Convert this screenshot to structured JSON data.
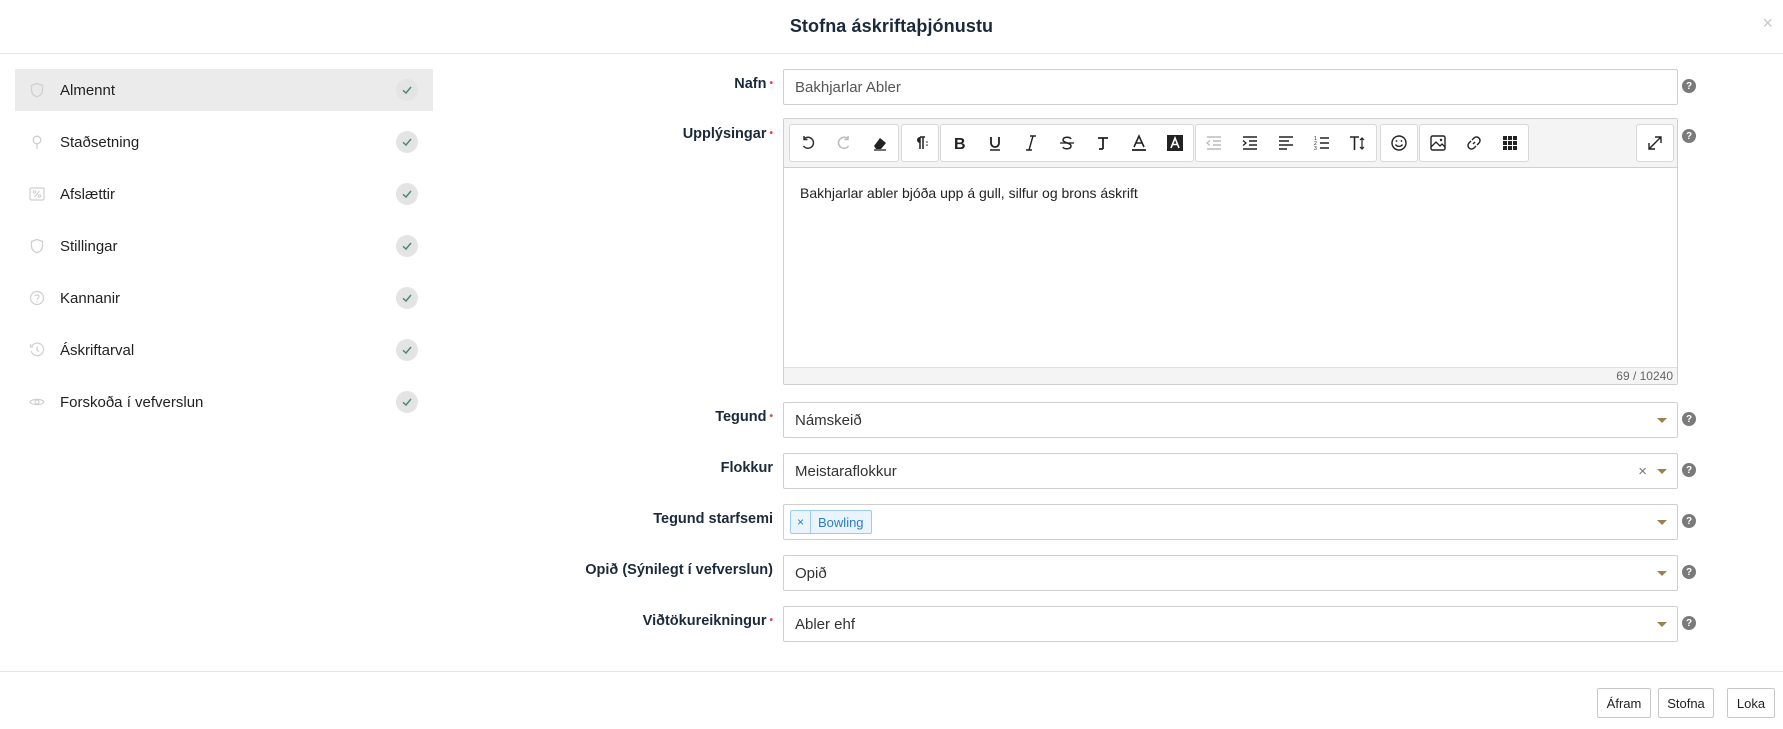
{
  "dialog": {
    "title": "Stofna áskriftaþjónustu",
    "close_glyph": "×"
  },
  "sidebar": {
    "items": [
      {
        "label": "Almennt",
        "icon": "shield-icon",
        "active": true
      },
      {
        "label": "Staðsetning",
        "icon": "map-pin-icon"
      },
      {
        "label": "Afslættir",
        "icon": "percent-icon"
      },
      {
        "label": "Stillingar",
        "icon": "shield-icon"
      },
      {
        "label": "Kannanir",
        "icon": "question-icon"
      },
      {
        "label": "Áskriftarval",
        "icon": "clock-refresh-icon"
      },
      {
        "label": "Forskoða í vefverslun",
        "icon": "eye-icon"
      }
    ]
  },
  "form": {
    "name": {
      "label": "Nafn",
      "value": "Bakhjarlar Abler"
    },
    "info": {
      "label": "Upplýsingar",
      "content": "Bakhjarlar abler bjóða upp á gull, silfur og brons áskrift",
      "counter": "69 / 10240"
    },
    "type": {
      "label": "Tegund",
      "value": "Námskeið"
    },
    "category": {
      "label": "Flokkur",
      "value": "Meistaraflokkur",
      "clear": "×"
    },
    "activity": {
      "label": "Tegund starfsemi",
      "tags": [
        {
          "label": "Bowling",
          "remove": "×"
        }
      ]
    },
    "open": {
      "label": "Opið (Sýnilegt í vefverslun)",
      "value": "Opið"
    },
    "account": {
      "label": "Viðtökureikningur",
      "value": "Abler ehf"
    },
    "required_mark": "•",
    "help_glyph": "?"
  },
  "footer": {
    "next": "Áfram",
    "create": "Stofna",
    "close": "Loka"
  },
  "colors": {
    "accent_caret": "#9a8150",
    "check_bg": "#e4e4e4",
    "check_mark": "#4a8c78",
    "tag_blue": "#2a7dc7"
  }
}
